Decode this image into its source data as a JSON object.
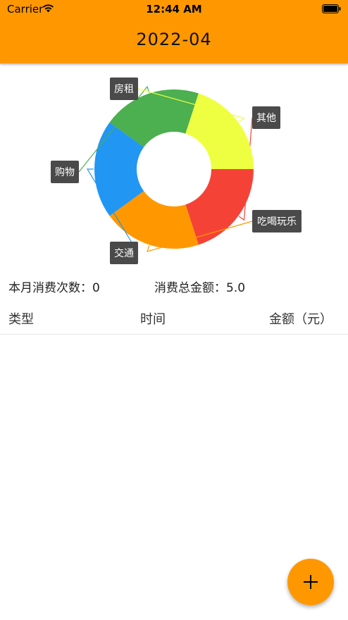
{
  "status_bar": {
    "carrier": "Carrier",
    "time": "12:44 AM",
    "wifi_icon": "wifi-icon",
    "battery_icon": "battery-icon"
  },
  "nav": {
    "title": "2022-04"
  },
  "chart_data": {
    "type": "pie",
    "variant": "donut",
    "categories": [
      "其他",
      "吃喝玩乐",
      "交通",
      "购物",
      "房租"
    ],
    "values": [
      20,
      20,
      20,
      20,
      20
    ],
    "colors": [
      "#f44336",
      "#ff9800",
      "#2196f3",
      "#4caf50",
      "#eeff41"
    ],
    "labels_style": "outside-with-leader-lines"
  },
  "summary": {
    "count_label": "本月消费次数：",
    "count_value": "0",
    "total_label": "消费总金额：",
    "total_value": "5.0"
  },
  "table": {
    "columns": [
      "类型",
      "时间",
      "金额（元）"
    ],
    "rows": []
  },
  "fab": {
    "icon": "plus-icon",
    "color": "#ff9800"
  },
  "theme": {
    "accent": "#ff9800"
  }
}
